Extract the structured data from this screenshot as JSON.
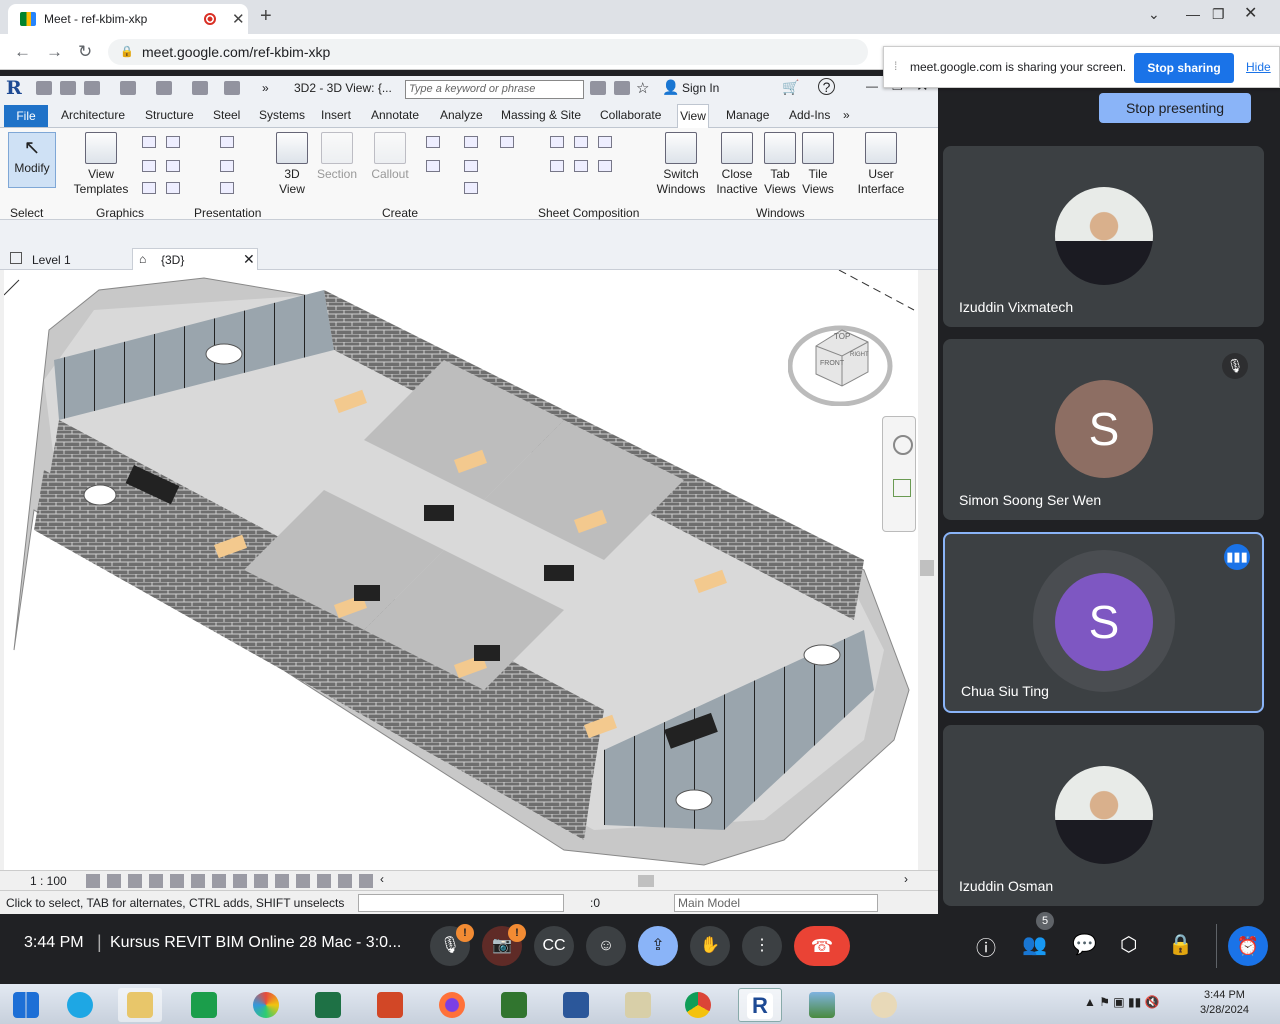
{
  "browser": {
    "tab_title": "Meet - ref-kbim-xkp",
    "url": "meet.google.com/ref-kbim-xkp"
  },
  "share_banner": {
    "message": "meet.google.com is sharing your screen.",
    "stop_sharing": "Stop sharing",
    "hide": "Hide"
  },
  "revit": {
    "view_title": "3D2 - 3D View: {...",
    "search_placeholder": "Type a keyword or phrase",
    "sign_in": "Sign In",
    "menu": [
      "File",
      "Architecture",
      "Structure",
      "Steel",
      "Systems",
      "Insert",
      "Annotate",
      "Analyze",
      "Massing & Site",
      "Collaborate",
      "View",
      "Manage",
      "Add-Ins"
    ],
    "ribbon": {
      "modify": "Modify",
      "select": "Select",
      "view_templates": [
        "View",
        "Templates"
      ],
      "graphics": "Graphics",
      "presentation": "Presentation",
      "view3d": [
        "3D",
        "View"
      ],
      "section": "Section",
      "callout": "Callout",
      "create": "Create",
      "sheet_composition": "Sheet Composition",
      "switch_windows": [
        "Switch",
        "Windows"
      ],
      "close_inactive": [
        "Close",
        "Inactive"
      ],
      "tab_views": [
        "Tab",
        "Views"
      ],
      "tile_views": [
        "Tile",
        "Views"
      ],
      "user_interface": [
        "User",
        "Interface"
      ],
      "windows": "Windows"
    },
    "view_tabs": [
      "Level 1",
      "{3D}"
    ],
    "viewcube": {
      "top": "TOP",
      "front": "FRONT",
      "right": "RIGHT"
    },
    "scale": "1 : 100",
    "status": "Click to select, TAB for alternates, CTRL adds, SHIFT unselects",
    "filter_count": ":0",
    "main_model": "Main Model"
  },
  "meet": {
    "stop_presenting": "Stop presenting",
    "participants": [
      {
        "name": "Izuddin Vixmatech",
        "type": "photo"
      },
      {
        "name": "Simon Soong Ser Wen",
        "type": "letter",
        "letter": "S",
        "color": "#8d6e63",
        "muted": true
      },
      {
        "name": "Chua Siu Ting",
        "type": "letter",
        "letter": "S",
        "color": "#7e57c2",
        "speaking": true
      },
      {
        "name": "Izuddin Osman",
        "type": "photo"
      }
    ],
    "time": "3:44 PM",
    "meeting_title": "Kursus REVIT BIM Online 28 Mac - 3:0...",
    "people_count": "5"
  },
  "taskbar": {
    "time": "3:44 PM",
    "date": "3/28/2024"
  }
}
